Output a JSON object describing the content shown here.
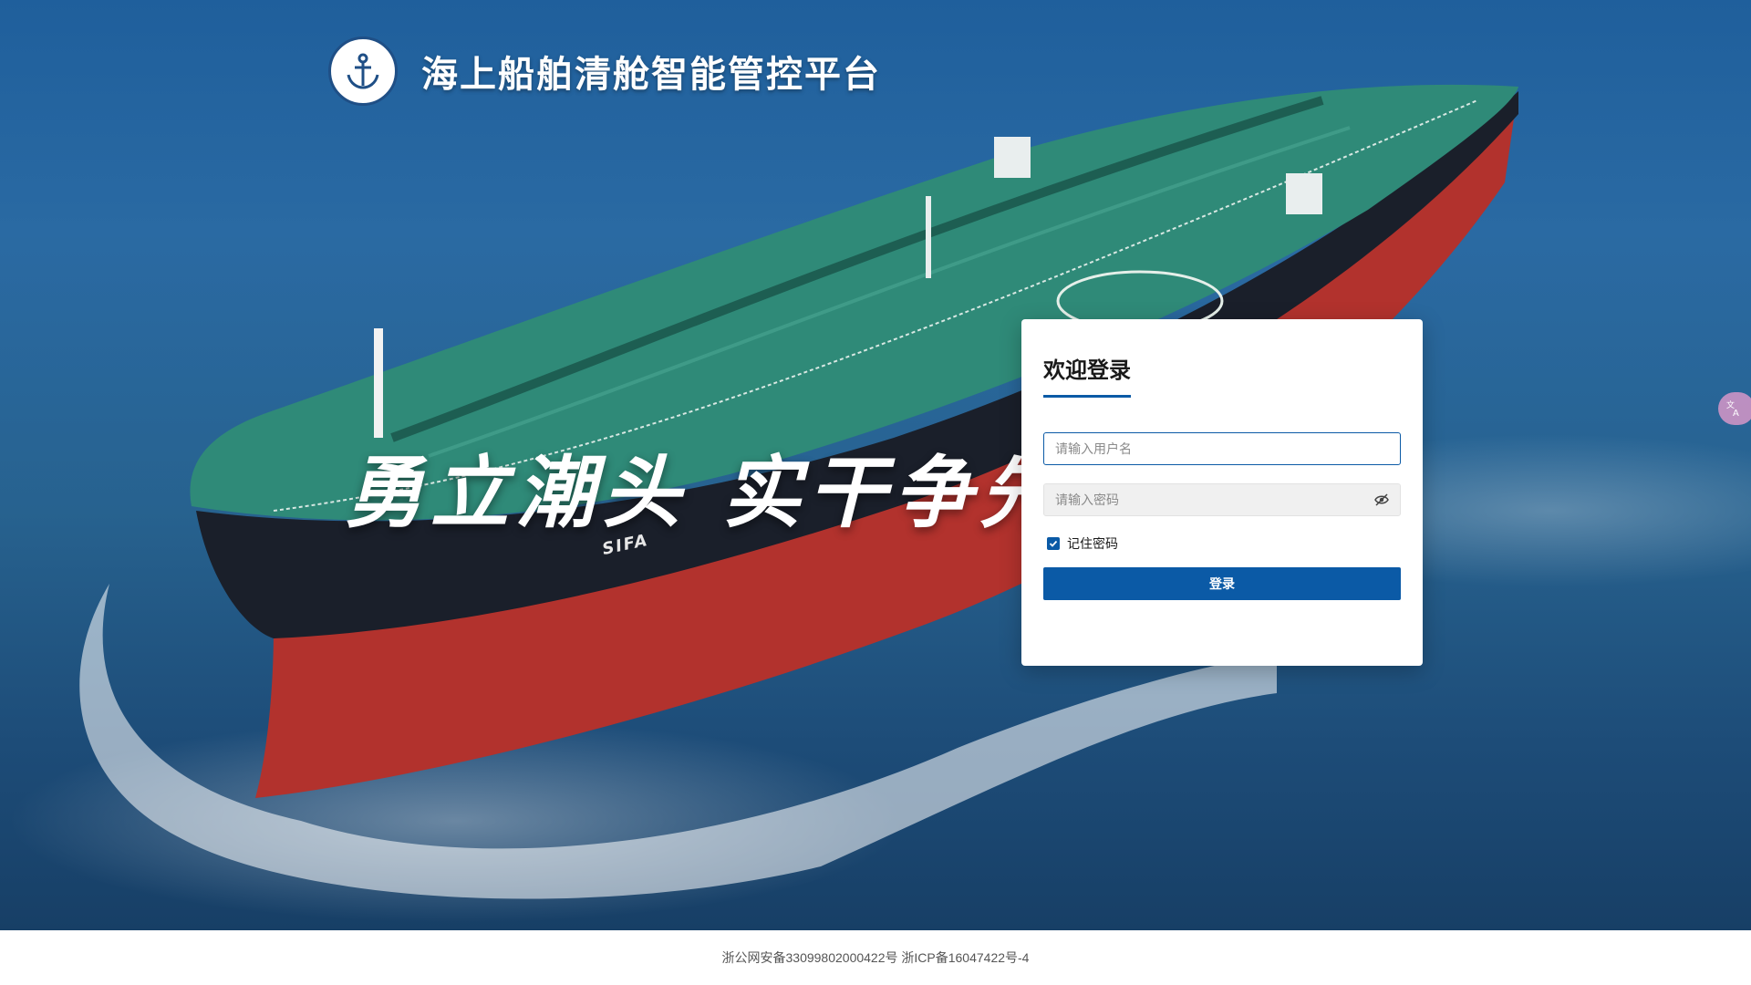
{
  "header": {
    "title": "海上船舶清舱智能管控平台",
    "logo_icon": "anchor-emblem-icon"
  },
  "hero": {
    "slogan": "勇立潮头 实干争先",
    "ship_name": "SIFA"
  },
  "login": {
    "title": "欢迎登录",
    "username_placeholder": "请输入用户名",
    "password_placeholder": "请输入密码",
    "password_toggle_icon": "eye-off-icon",
    "remember_label": "记住密码",
    "remember_checked": true,
    "submit_label": "登录"
  },
  "side_widget": {
    "icon": "translate-icon"
  },
  "footer": {
    "icp_text": "浙公网安备33099802000422号 浙ICP备16047422号-4"
  },
  "colors": {
    "primary": "#0b5aa6",
    "hull_red": "#b2322d",
    "hull_black": "#1a1f2a",
    "deck_green": "#2f8a78",
    "sea_blue": "#235f97"
  }
}
